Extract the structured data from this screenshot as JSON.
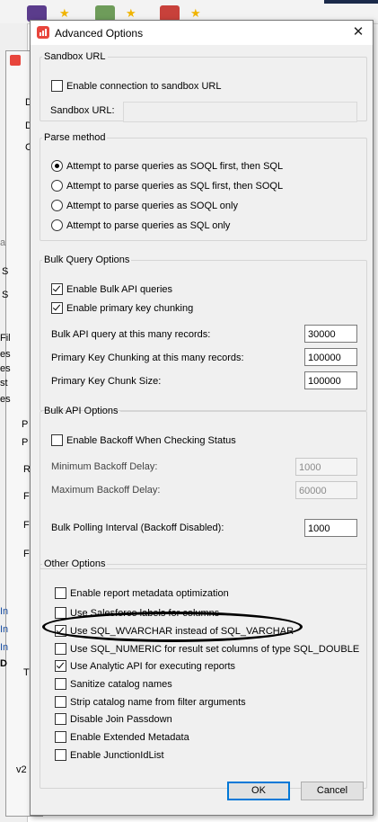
{
  "background": {
    "fragments": [
      "D",
      "D",
      "C",
      "a",
      "S",
      "S",
      "Fil",
      "es",
      "es",
      "st",
      "es",
      "P",
      "P",
      "R",
      "F",
      "F",
      "F",
      "In",
      "In",
      "In",
      "D",
      "T",
      "v2"
    ]
  },
  "dialog": {
    "title": "Advanced Options",
    "close_glyph": "✕",
    "sandbox": {
      "legend": "Sandbox URL",
      "enable_label": "Enable connection to sandbox URL",
      "enable_checked": false,
      "url_label": "Sandbox URL:",
      "url_value": ""
    },
    "parse": {
      "legend": "Parse method",
      "options": [
        {
          "label": "Attempt to parse queries as SOQL first, then SQL",
          "checked": true
        },
        {
          "label": "Attempt to parse queries as SQL first, then SOQL",
          "checked": false
        },
        {
          "label": "Attempt to parse queries as SOQL only",
          "checked": false
        },
        {
          "label": "Attempt to parse queries as SQL only",
          "checked": false
        }
      ]
    },
    "bulk_query": {
      "legend": "Bulk Query Options",
      "enable_bulk_label": "Enable Bulk API queries",
      "enable_bulk_checked": true,
      "enable_chunk_label": "Enable primary key chunking",
      "enable_chunk_checked": true,
      "records_label": "Bulk API query at this many records:",
      "records_value": "30000",
      "chunking_label": "Primary Key Chunking at this many records:",
      "chunking_value": "100000",
      "chunk_size_label": "Primary Key Chunk Size:",
      "chunk_size_value": "100000"
    },
    "bulk_api": {
      "legend": "Bulk API Options",
      "backoff_label": "Enable Backoff When Checking Status",
      "backoff_checked": false,
      "min_label": "Minimum Backoff Delay:",
      "min_value": "1000",
      "max_label": "Maximum Backoff Delay:",
      "max_value": "60000",
      "polling_label": "Bulk Polling Interval (Backoff Disabled):",
      "polling_value": "1000"
    },
    "other": {
      "legend": "Other Options",
      "options": [
        {
          "label": "Enable report metadata optimization",
          "checked": false
        },
        {
          "label": "Use Salesforce labels for columns",
          "checked": false
        },
        {
          "label": "Use SQL_WVARCHAR instead of SQL_VARCHAR",
          "checked": true
        },
        {
          "label": "Use SQL_NUMERIC for result set columns of type SQL_DOUBLE",
          "checked": false
        },
        {
          "label": "Use Analytic API for executing reports",
          "checked": true
        },
        {
          "label": "Sanitize catalog names",
          "checked": false
        },
        {
          "label": "Strip catalog name from filter arguments",
          "checked": false
        },
        {
          "label": "Disable Join Passdown",
          "checked": false
        },
        {
          "label": "Enable Extended Metadata",
          "checked": false
        },
        {
          "label": "Enable JunctionIdList",
          "checked": false
        }
      ]
    },
    "ok_label": "OK",
    "cancel_label": "Cancel"
  },
  "colors": {
    "dialog_bg": "#f0f0f0",
    "default_button_border": "#0078d7",
    "annotation_ellipse": "#000000"
  }
}
